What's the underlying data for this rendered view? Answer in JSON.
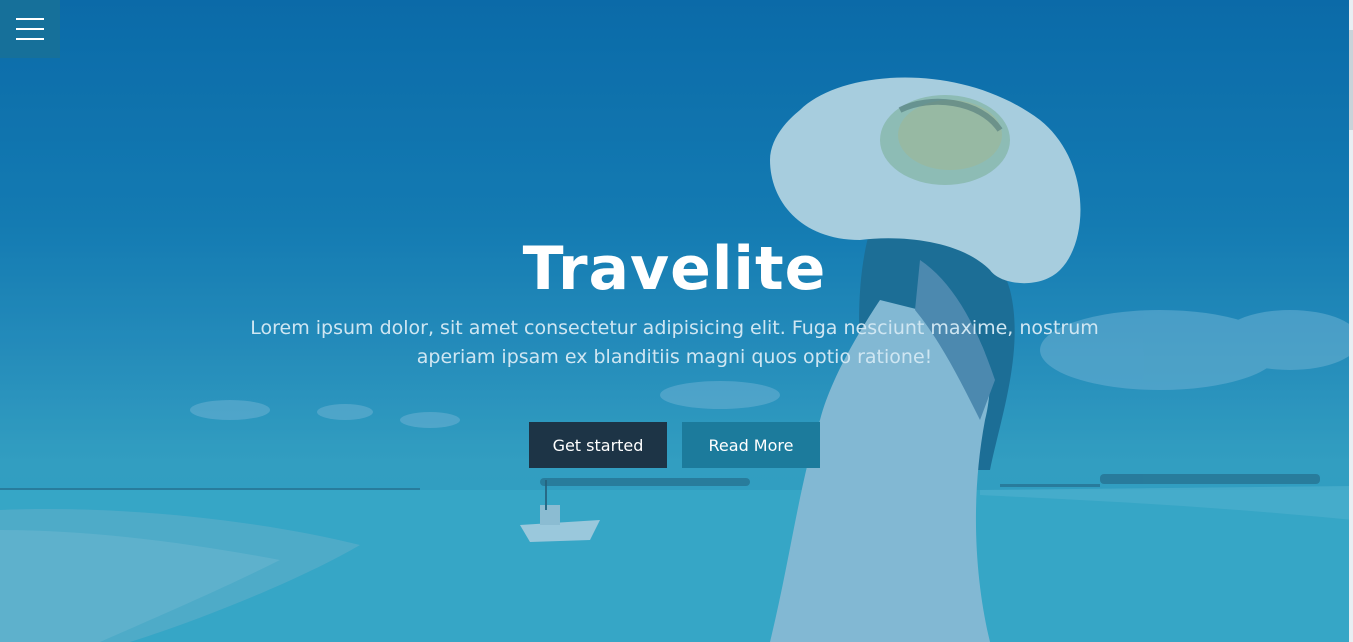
{
  "hero": {
    "title": "Travelite",
    "subtitle": "Lorem ipsum dolor, sit amet consectetur adipisicing elit. Fuga nesciunt maxime, nostrum aperiam ipsam ex blanditiis magni quos optio ratione!",
    "buttons": {
      "primary_label": "Get started",
      "secondary_label": "Read More"
    }
  },
  "menu": {
    "icon": "hamburger-menu-icon"
  },
  "colors": {
    "primary_button": "#1d3446",
    "secondary_button": "#1c7b9c",
    "menu_button": "#16709a",
    "title": "#ffffff",
    "subtitle": "#cfe6f2"
  }
}
